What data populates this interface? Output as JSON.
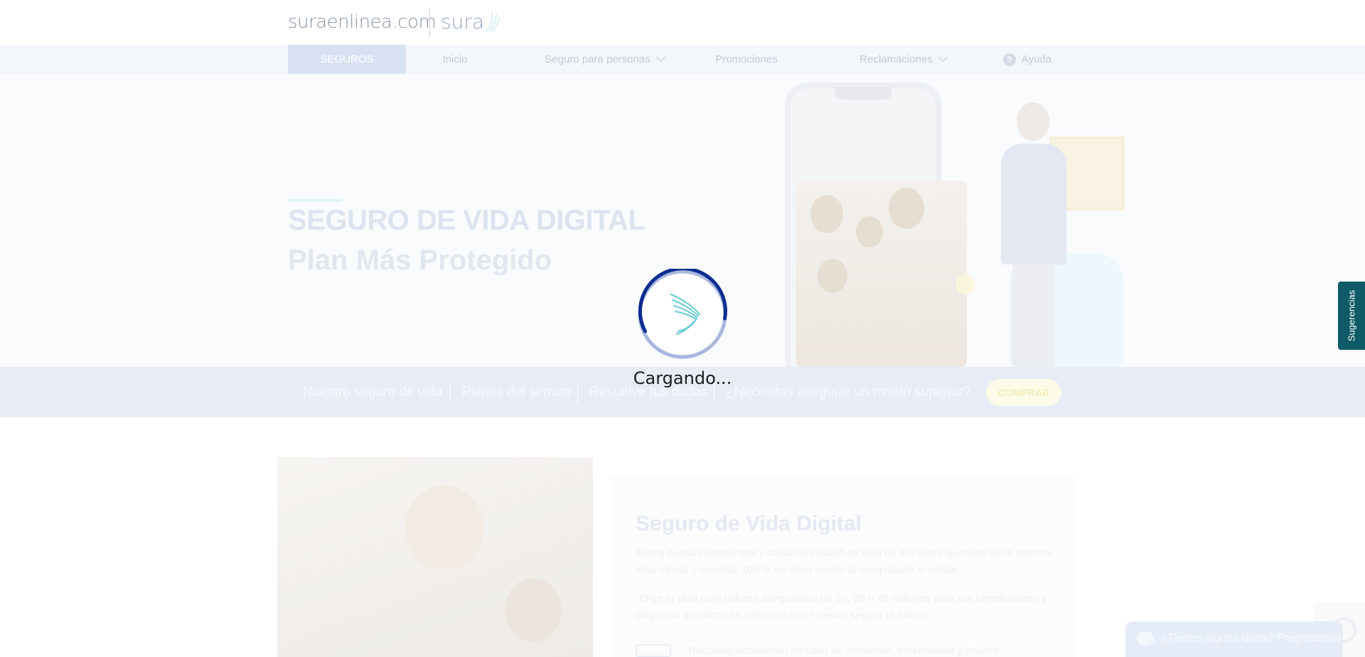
{
  "header": {
    "logo_text": "suraenlinea.com",
    "brand_text": "sura"
  },
  "nav": {
    "items": [
      {
        "label": "SEGUROS",
        "active": true
      },
      {
        "label": "Inicio"
      },
      {
        "label": "Seguro para personas",
        "dropdown": true
      },
      {
        "label": "Promociones"
      },
      {
        "label": "Reclamaciones",
        "dropdown": true
      },
      {
        "label": "Ayuda",
        "icon": "help-circle-icon"
      }
    ],
    "help_glyph": "?"
  },
  "hero": {
    "title": "SEGURO DE VIDA DIGITAL",
    "subtitle": "Plan Más Protegido"
  },
  "subnav": {
    "items": [
      {
        "label": "Nuestro seguro de vida"
      },
      {
        "label": "Planes del seguro"
      },
      {
        "label": "Resuelve tus dudas"
      },
      {
        "label": "¿Necesitas asegurar un monto superior?"
      }
    ],
    "buy_label": "COMPRAR"
  },
  "content": {
    "title": "Seguro de Vida Digital",
    "paragraph_1": "Ahora puedas asegurarte y cuidar la calidad de vida de tus seres queridos de la manera más rápida y sencilla: 100 % en línea desde tu computador o celular.",
    "paragraph_2": "¡Elige tu plan (con valores asegurados de 10, 20 o 40 millones para tus beneficiarios) y diligencia tus datos en solo minutos! Nuestro seguro te brinda:",
    "bullet_1": "Respaldo económico en caso de accidente, enfermedad y muerte"
  },
  "loader": {
    "text": "Cargando..."
  },
  "side_tab": {
    "label": "Sugerencias"
  },
  "chat": {
    "label": "¿Tienes alguna duda? Pregúntanos"
  },
  "colors": {
    "brand_dark": "#0e5a66",
    "spinner_blue": "#0b2d8f",
    "spinner_light": "#9fb0dd",
    "wing": "#6fd0d6"
  }
}
